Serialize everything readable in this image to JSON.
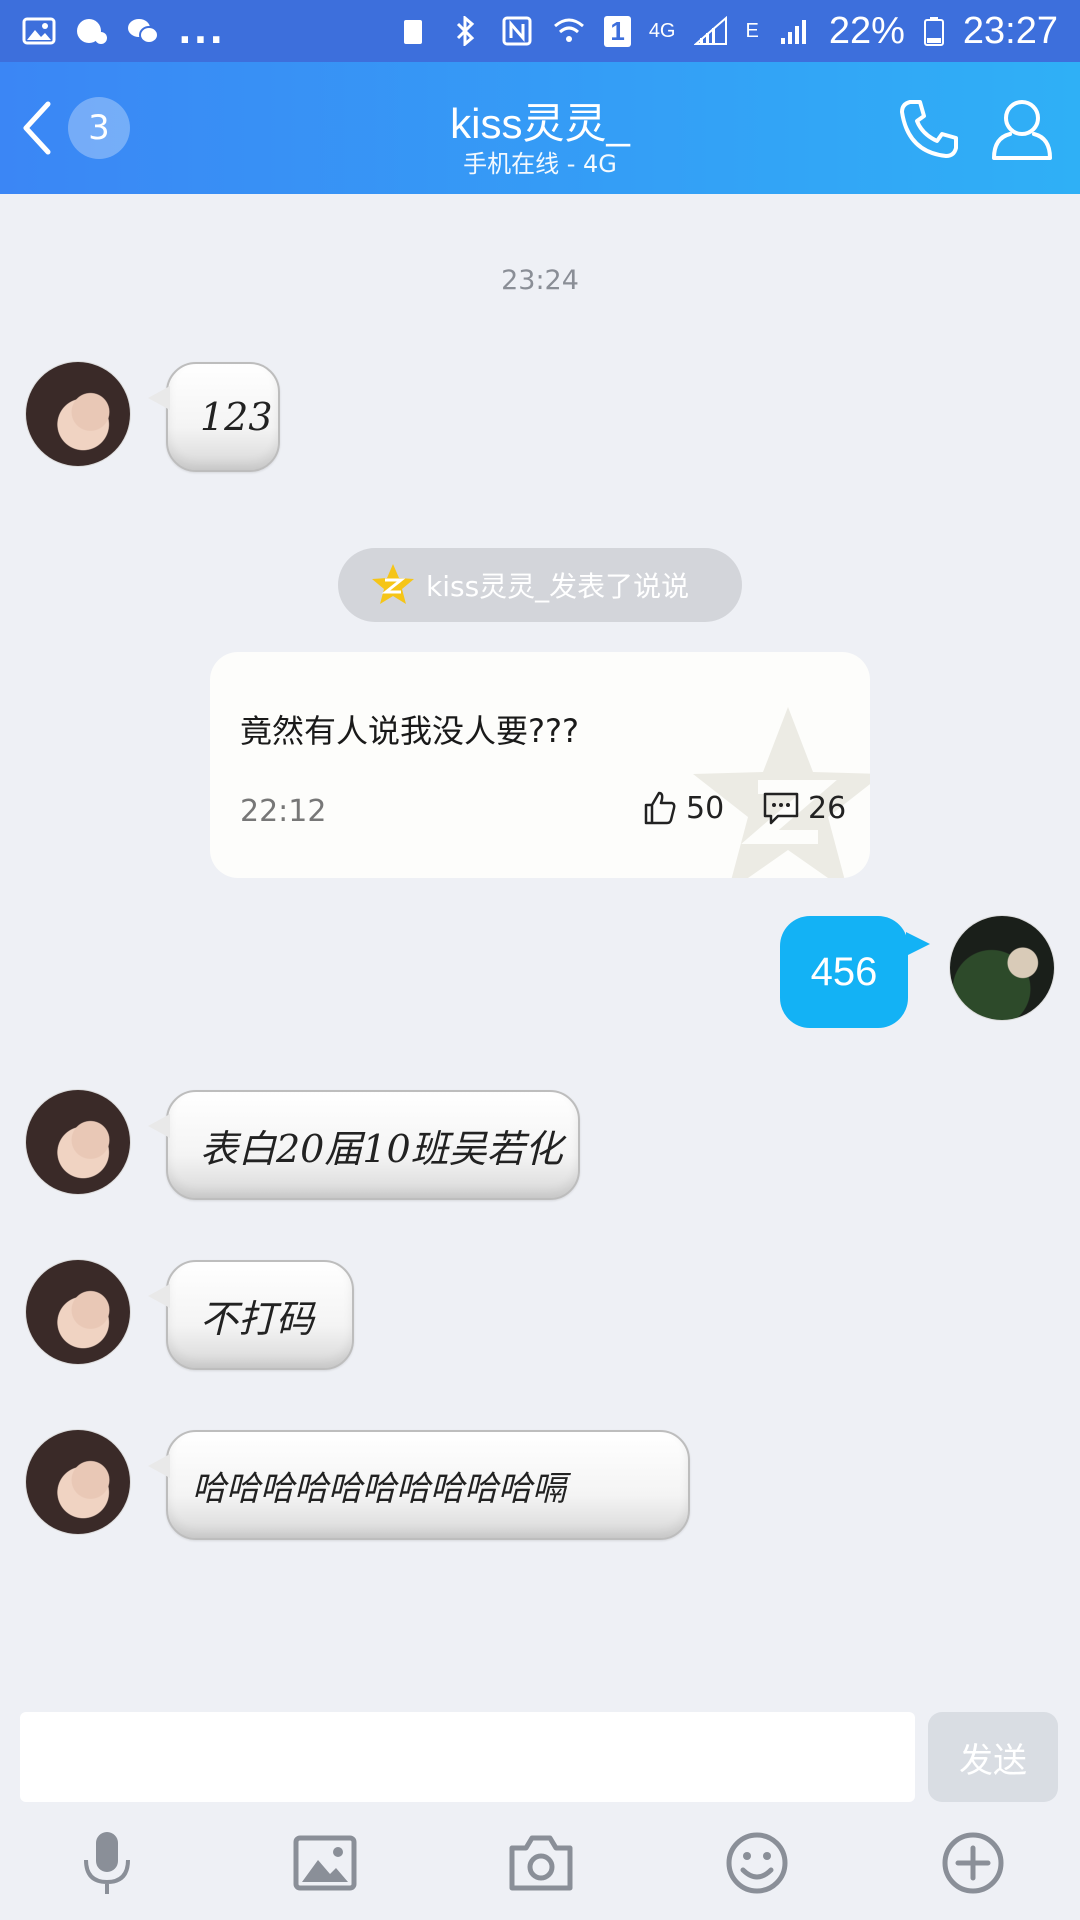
{
  "status_bar": {
    "dots": "...",
    "sim_badge": "1",
    "network_4g": "4G",
    "network_e": "E",
    "battery": "22%",
    "time": "23:27"
  },
  "header": {
    "back_count": "3",
    "title": "kiss灵灵_",
    "subtitle": "手机在线 - 4G"
  },
  "chat": {
    "timestamp": "23:24",
    "msg1": "123",
    "notice": "kiss灵灵_发表了说说",
    "post": {
      "text": "竟然有人说我没人要???",
      "time": "22:12",
      "likes": "50",
      "comments": "26"
    },
    "msg_me": "456",
    "msg2": "表白20届10班吴若化",
    "msg3": "不打码",
    "msg4": "哈哈哈哈哈哈哈哈哈哈嗝"
  },
  "input": {
    "placeholder": "",
    "send_label": "发送"
  },
  "toolbar": {
    "icons": [
      "microphone-icon",
      "image-icon",
      "camera-icon",
      "emoji-icon",
      "plus-icon"
    ]
  },
  "colors": {
    "header_start": "#3b86f5",
    "header_end": "#2fb0f6",
    "my_bubble": "#13b2f5",
    "background": "#eef0f5"
  }
}
